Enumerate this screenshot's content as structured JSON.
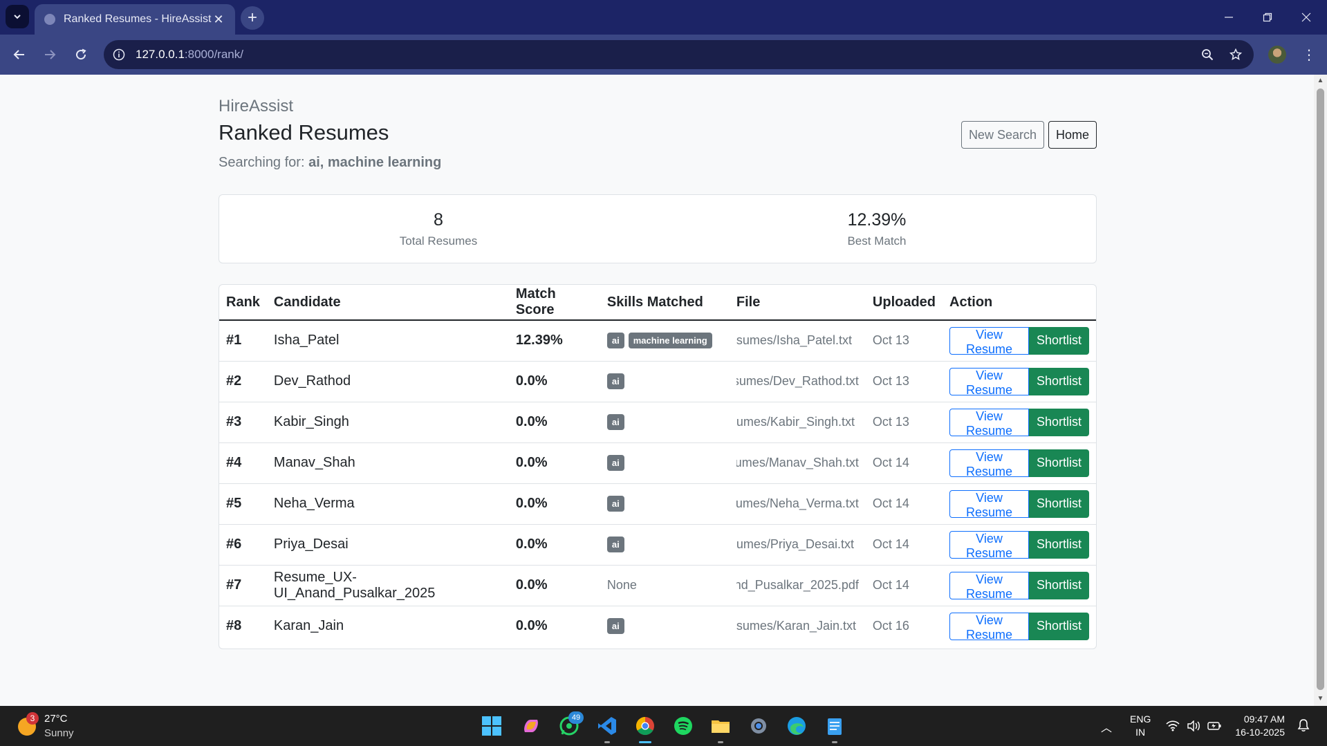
{
  "browser": {
    "tab_title": "Ranked Resumes - HireAssist",
    "url_host": "127.0.0.1",
    "url_path": ":8000/rank/"
  },
  "page": {
    "brand": "HireAssist",
    "title": "Ranked Resumes",
    "searching_label": "Searching for:",
    "searching_terms": "ai, machine learning",
    "new_search_label": "New Search",
    "home_label": "Home"
  },
  "stats": {
    "total_value": "8",
    "total_label": "Total Resumes",
    "best_value": "12.39%",
    "best_label": "Best Match"
  },
  "table": {
    "headers": [
      "Rank",
      "Candidate",
      "Match Score",
      "Skills Matched",
      "File",
      "Uploaded",
      "Action"
    ],
    "view_label": "View Resume",
    "shortlist_label": "Shortlist",
    "rows": [
      {
        "rank": "#1",
        "candidate": "Isha_Patel",
        "score": "12.39%",
        "skills": [
          "ai",
          "machine learning"
        ],
        "file": "sumes/Isha_Patel.txt",
        "uploaded": "Oct 13"
      },
      {
        "rank": "#2",
        "candidate": "Dev_Rathod",
        "score": "0.0%",
        "skills": [
          "ai"
        ],
        "file": "sumes/Dev_Rathod.txt",
        "uploaded": "Oct 13"
      },
      {
        "rank": "#3",
        "candidate": "Kabir_Singh",
        "score": "0.0%",
        "skills": [
          "ai"
        ],
        "file": "umes/Kabir_Singh.txt",
        "uploaded": "Oct 13"
      },
      {
        "rank": "#4",
        "candidate": "Manav_Shah",
        "score": "0.0%",
        "skills": [
          "ai"
        ],
        "file": "sumes/Manav_Shah.txt",
        "uploaded": "Oct 14"
      },
      {
        "rank": "#5",
        "candidate": "Neha_Verma",
        "score": "0.0%",
        "skills": [
          "ai"
        ],
        "file": "sumes/Neha_Verma.txt",
        "uploaded": "Oct 14"
      },
      {
        "rank": "#6",
        "candidate": "Priya_Desai",
        "score": "0.0%",
        "skills": [
          "ai"
        ],
        "file": "umes/Priya_Desai.txt",
        "uploaded": "Oct 14"
      },
      {
        "rank": "#7",
        "candidate": "Resume_UX-UI_Anand_Pusalkar_2025",
        "score": "0.0%",
        "skills": [],
        "skills_none": "None",
        "file": "nd_Pusalkar_2025.pdf",
        "uploaded": "Oct 14"
      },
      {
        "rank": "#8",
        "candidate": "Karan_Jain",
        "score": "0.0%",
        "skills": [
          "ai"
        ],
        "file": "sumes/Karan_Jain.txt",
        "uploaded": "Oct 16"
      }
    ]
  },
  "taskbar": {
    "weather_badge": "3",
    "weather_temp": "27°C",
    "weather_desc": "Sunny",
    "whatsapp_badge": "49",
    "lang_top": "ENG",
    "lang_bottom": "IN",
    "time": "09:47 AM",
    "date": "16-10-2025"
  },
  "colors": {
    "tabbar": "#1c2466",
    "toolbar": "#3a4684",
    "primary": "#0d6efd",
    "success": "#198754",
    "secondary": "#6c757d"
  }
}
